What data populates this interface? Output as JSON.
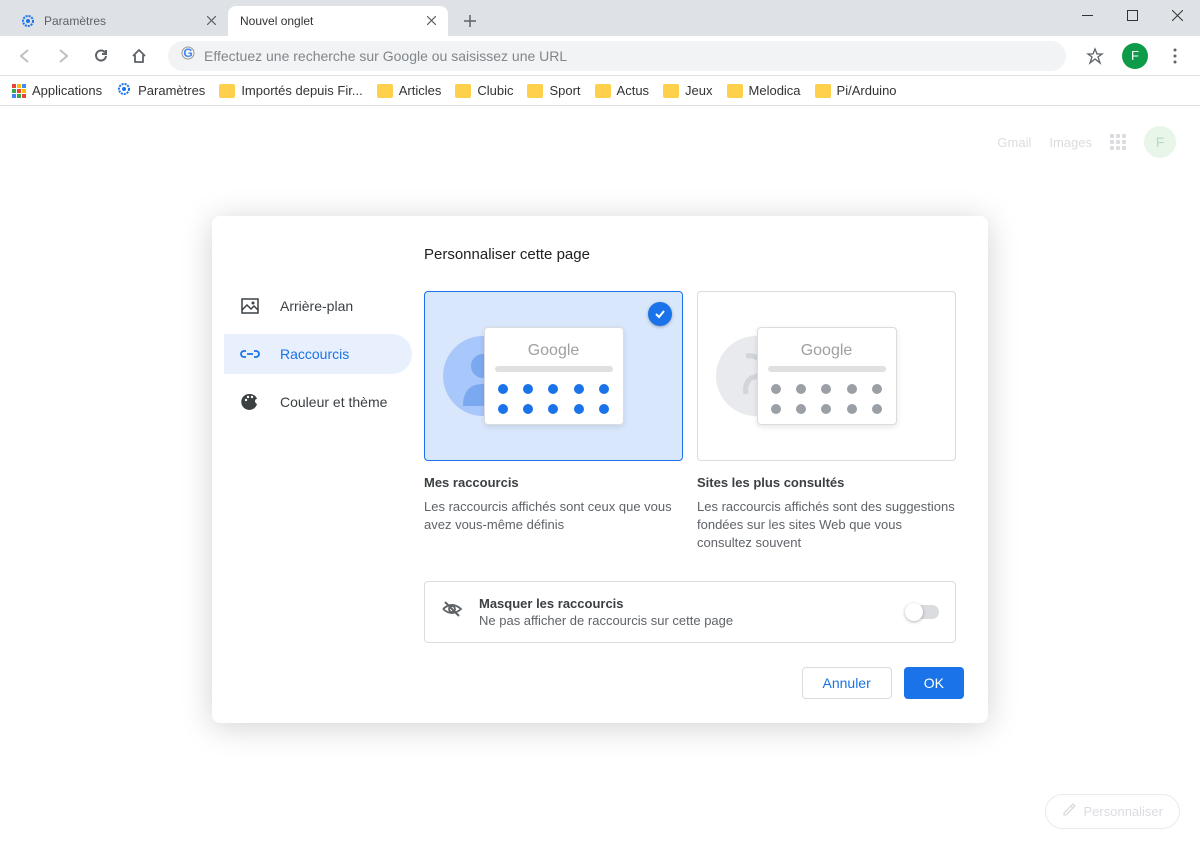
{
  "tabs": [
    {
      "title": "Paramètres"
    },
    {
      "title": "Nouvel onglet"
    }
  ],
  "omnibox": {
    "placeholder": "Effectuez une recherche sur Google ou saisissez une URL"
  },
  "profile": {
    "initial": "F"
  },
  "bookmarks": {
    "apps": "Applications",
    "items": [
      "Paramètres",
      "Importés depuis Fir...",
      "Articles",
      "Clubic",
      "Sport",
      "Actus",
      "Jeux",
      "Melodica",
      "Pi/Arduino"
    ]
  },
  "page": {
    "gmail": "Gmail",
    "images": "Images",
    "avatar": "F",
    "customize": "Personnaliser"
  },
  "dialog": {
    "title": "Personnaliser cette page",
    "sidebar": [
      {
        "label": "Arrière-plan"
      },
      {
        "label": "Raccourcis"
      },
      {
        "label": "Couleur et thème"
      }
    ],
    "options": [
      {
        "title": "Mes raccourcis",
        "desc": "Les raccourcis affichés sont ceux que vous avez vous-même définis",
        "logo": "Google"
      },
      {
        "title": "Sites les plus consultés",
        "desc": "Les raccourcis affichés sont des suggestions fondées sur les sites Web que vous consultez souvent",
        "logo": "Google"
      }
    ],
    "hide": {
      "title": "Masquer les raccourcis",
      "desc": "Ne pas afficher de raccourcis sur cette page"
    },
    "footer": {
      "cancel": "Annuler",
      "ok": "OK"
    }
  }
}
